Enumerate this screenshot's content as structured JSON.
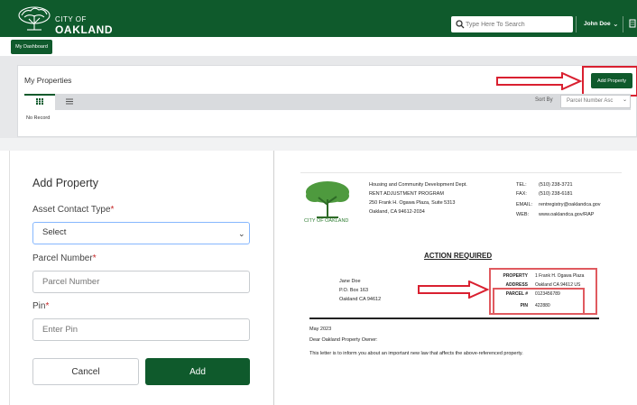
{
  "header": {
    "logo_line1": "CITY OF",
    "logo_line2": "OAKLAND",
    "search_placeholder": "Type Here To Search",
    "user_name": "John Doe",
    "bg_color": "#0f5a2c"
  },
  "nav": {
    "dashboard_label": "My Dashboard"
  },
  "properties": {
    "title": "My Properties",
    "add_button": "Add Property",
    "sort_label": "Sort By",
    "sort_value": "Parcel Number Asc",
    "empty_text": "No Record"
  },
  "form": {
    "title": "Add Property",
    "contact_type_label": "Asset Contact Type",
    "contact_type_value": "Select",
    "parcel_label": "Parcel Number",
    "parcel_placeholder": "Parcel Number",
    "pin_label": "Pin",
    "pin_placeholder": "Enter Pin",
    "required_mark": "*",
    "cancel_label": "Cancel",
    "submit_label": "Add"
  },
  "letter": {
    "city_caption": "CITY OF OAKLAND",
    "dept_lines": [
      "Housing and Community Development Dept.",
      "RENT ADJUSTMENT PROGRAM",
      "250 Frank H. Ogawa Plaza, Suite 5313",
      "Oakland, CA 94612-2034"
    ],
    "contact_keys": [
      "TEL:",
      "FAX:",
      "EMAIL:",
      "WEB:"
    ],
    "contact_values": [
      "(510) 238-3721",
      "(510) 238-6181",
      "rentregistry@oaklandca.gov",
      "www.oaklandca.gov/RAP"
    ],
    "heading": "ACTION REQUIRED",
    "recipient_lines": [
      "Jane Doe",
      "P.O. Box 163",
      "Oakland CA 94612"
    ],
    "property_keys": [
      "PROPERTY",
      "ADDRESS",
      "PARCEL #",
      "PIN"
    ],
    "property_values": [
      "1 Frank H. Ogawa Plaza",
      "Oakland CA 94612 US",
      "0123456789",
      "422880"
    ],
    "date": "May 2023",
    "greeting": "Dear Oakland Property Owner:",
    "body": "This letter is to inform you about an important new law that affects the above-referenced property."
  },
  "colors": {
    "brand": "#0f5a2c",
    "highlight": "#d92030"
  }
}
